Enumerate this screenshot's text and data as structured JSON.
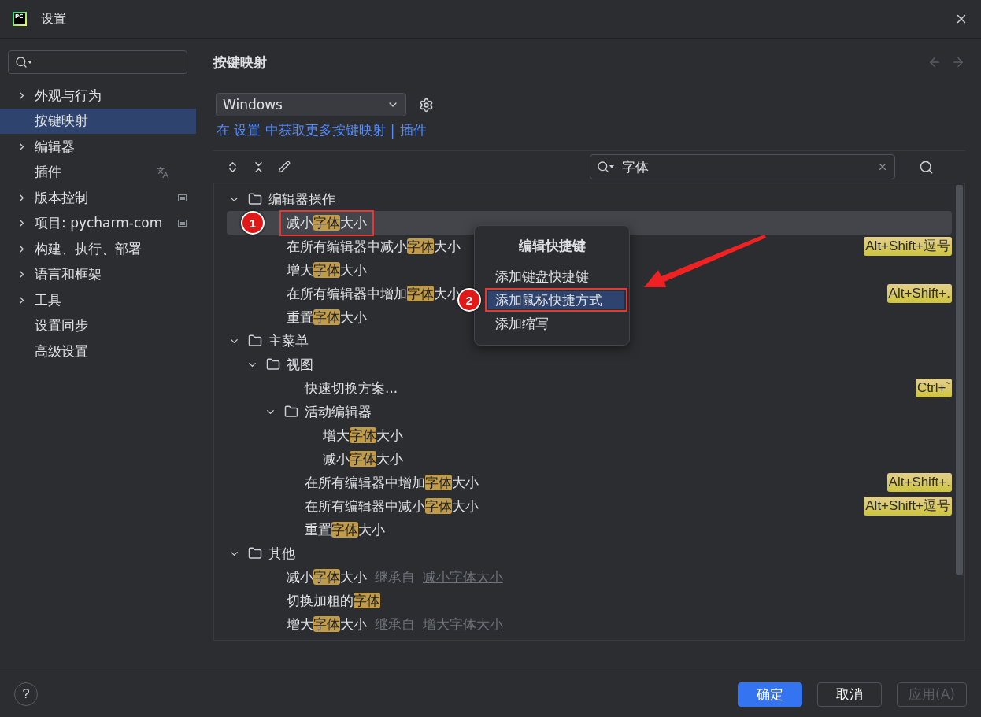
{
  "window": {
    "title": "设置",
    "logo_text": "PC"
  },
  "sidebar": {
    "items": [
      {
        "label": "外观与行为",
        "expandable": true,
        "selected": false,
        "kind": "plain"
      },
      {
        "label": "按键映射",
        "expandable": false,
        "selected": true,
        "kind": "plain"
      },
      {
        "label": "编辑器",
        "expandable": true,
        "selected": false,
        "kind": "plain"
      },
      {
        "label": "插件",
        "expandable": false,
        "selected": false,
        "kind": "translated"
      },
      {
        "label": "版本控制",
        "expandable": true,
        "selected": false,
        "kind": "project"
      },
      {
        "label": "项目: pycharm-com",
        "expandable": true,
        "selected": false,
        "kind": "project"
      },
      {
        "label": "构建、执行、部署",
        "expandable": true,
        "selected": false,
        "kind": "plain"
      },
      {
        "label": "语言和框架",
        "expandable": true,
        "selected": false,
        "kind": "plain"
      },
      {
        "label": "工具",
        "expandable": true,
        "selected": false,
        "kind": "plain"
      },
      {
        "label": "设置同步",
        "expandable": false,
        "selected": false,
        "kind": "plain"
      },
      {
        "label": "高级设置",
        "expandable": false,
        "selected": false,
        "kind": "plain"
      }
    ]
  },
  "page": {
    "title": "按键映射",
    "keymap": "Windows",
    "link": "在 设置 中获取更多按键映射",
    "separator": "|",
    "plugins_link": "插件"
  },
  "search": {
    "value": "字体"
  },
  "tree": [
    {
      "kind": "folder",
      "label": "编辑器操作",
      "expanded": true,
      "children": [
        {
          "kind": "action",
          "selected": true,
          "outlined": true,
          "callout": "1",
          "parts": [
            {
              "text": "减小"
            },
            {
              "text": "字体",
              "match": true
            },
            {
              "text": "大小"
            }
          ]
        },
        {
          "kind": "action",
          "selected": false,
          "parts": [
            {
              "text": "在所有编辑器中减小"
            },
            {
              "text": "字体",
              "match": true
            },
            {
              "text": "大小"
            }
          ],
          "shortcut": "Alt+Shift+逗号"
        },
        {
          "kind": "action",
          "selected": false,
          "parts": [
            {
              "text": "增大"
            },
            {
              "text": "字体",
              "match": true
            },
            {
              "text": "大小"
            }
          ]
        },
        {
          "kind": "action",
          "selected": false,
          "parts": [
            {
              "text": "在所有编辑器中增加"
            },
            {
              "text": "字体",
              "match": true
            },
            {
              "text": "大小"
            }
          ],
          "shortcut": "Alt+Shift+."
        },
        {
          "kind": "action",
          "selected": false,
          "parts": [
            {
              "text": "重置"
            },
            {
              "text": "字体",
              "match": true
            },
            {
              "text": "大小"
            }
          ]
        }
      ]
    },
    {
      "kind": "folder",
      "label": "主菜单",
      "expanded": true,
      "children": [
        {
          "kind": "folder",
          "label": "视图",
          "expanded": true,
          "children": [
            {
              "kind": "action",
              "selected": false,
              "parts": [
                {
                  "text": "快速切换方案..."
                }
              ],
              "shortcut": "Ctrl+`"
            },
            {
              "kind": "folder",
              "label": "活动编辑器",
              "expanded": true,
              "children": [
                {
                  "kind": "action",
                  "selected": false,
                  "parts": [
                    {
                      "text": "增大"
                    },
                    {
                      "text": "字体",
                      "match": true
                    },
                    {
                      "text": "大小"
                    }
                  ]
                },
                {
                  "kind": "action",
                  "selected": false,
                  "parts": [
                    {
                      "text": "减小"
                    },
                    {
                      "text": "字体",
                      "match": true
                    },
                    {
                      "text": "大小"
                    }
                  ]
                }
              ]
            },
            {
              "kind": "action",
              "selected": false,
              "parts": [
                {
                  "text": "在所有编辑器中增加"
                },
                {
                  "text": "字体",
                  "match": true
                },
                {
                  "text": "大小"
                }
              ],
              "shortcut": "Alt+Shift+."
            },
            {
              "kind": "action",
              "selected": false,
              "parts": [
                {
                  "text": "在所有编辑器中减小"
                },
                {
                  "text": "字体",
                  "match": true
                },
                {
                  "text": "大小"
                }
              ],
              "shortcut": "Alt+Shift+逗号"
            },
            {
              "kind": "action",
              "selected": false,
              "parts": [
                {
                  "text": "重置"
                },
                {
                  "text": "字体",
                  "match": true
                },
                {
                  "text": "大小"
                }
              ]
            }
          ]
        }
      ]
    },
    {
      "kind": "folder",
      "label": "其他",
      "expanded": true,
      "children": [
        {
          "kind": "action",
          "selected": false,
          "parts": [
            {
              "text": "减小"
            },
            {
              "text": "字体",
              "match": true
            },
            {
              "text": "大小"
            }
          ],
          "note": "继承自",
          "link": "减小字体大小"
        },
        {
          "kind": "action",
          "selected": false,
          "parts": [
            {
              "text": "切换加粗的"
            },
            {
              "text": "字体",
              "match": true
            }
          ]
        },
        {
          "kind": "action",
          "selected": false,
          "parts": [
            {
              "text": "增大"
            },
            {
              "text": "字体",
              "match": true
            },
            {
              "text": "大小"
            }
          ],
          "note": "继承自",
          "link": "增大字体大小"
        }
      ]
    }
  ],
  "context_menu": {
    "title": "编辑快捷键",
    "items": [
      {
        "label": "添加键盘快捷键",
        "selected": false
      },
      {
        "label": "添加鼠标快捷方式",
        "selected": true,
        "outlined": true,
        "callout": "2",
        "arrow": true
      },
      {
        "label": "添加缩写",
        "selected": false
      }
    ]
  },
  "footer": {
    "help": "?",
    "buttons": [
      {
        "label": "确定",
        "kind": "primary",
        "disabled": false
      },
      {
        "label": "取消",
        "kind": "secondary",
        "disabled": false
      },
      {
        "label": "应用(A)",
        "kind": "secondary",
        "disabled": true
      }
    ]
  }
}
